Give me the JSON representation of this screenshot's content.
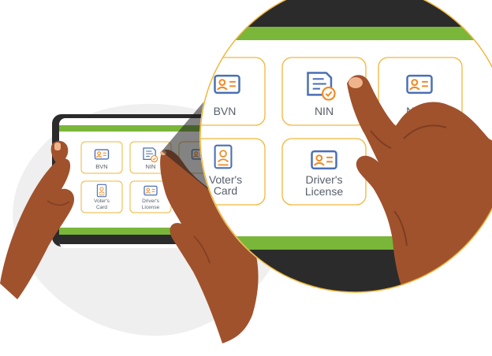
{
  "tiles": {
    "bvn": "BVN",
    "nin": "NIN",
    "nimc_partial": "NIMC",
    "voters_card_line1": "Voter's",
    "voters_card_line2": "Card",
    "drivers_license_line1": "Driver's",
    "drivers_license_line2": "License"
  },
  "icons": {
    "id_card": "id-card-icon",
    "document_check": "document-check-icon",
    "portrait_card": "portrait-card-icon"
  },
  "colors": {
    "screen_bezel": "#2b2b2b",
    "screen_green": "#79b63a",
    "tile_border": "#f2b63a",
    "icon_blue": "#4a6fb5",
    "icon_orange": "#f08a24",
    "skin": "#a0522d",
    "skin_shadow": "#7f3d21",
    "backdrop": "#eeeeee"
  }
}
